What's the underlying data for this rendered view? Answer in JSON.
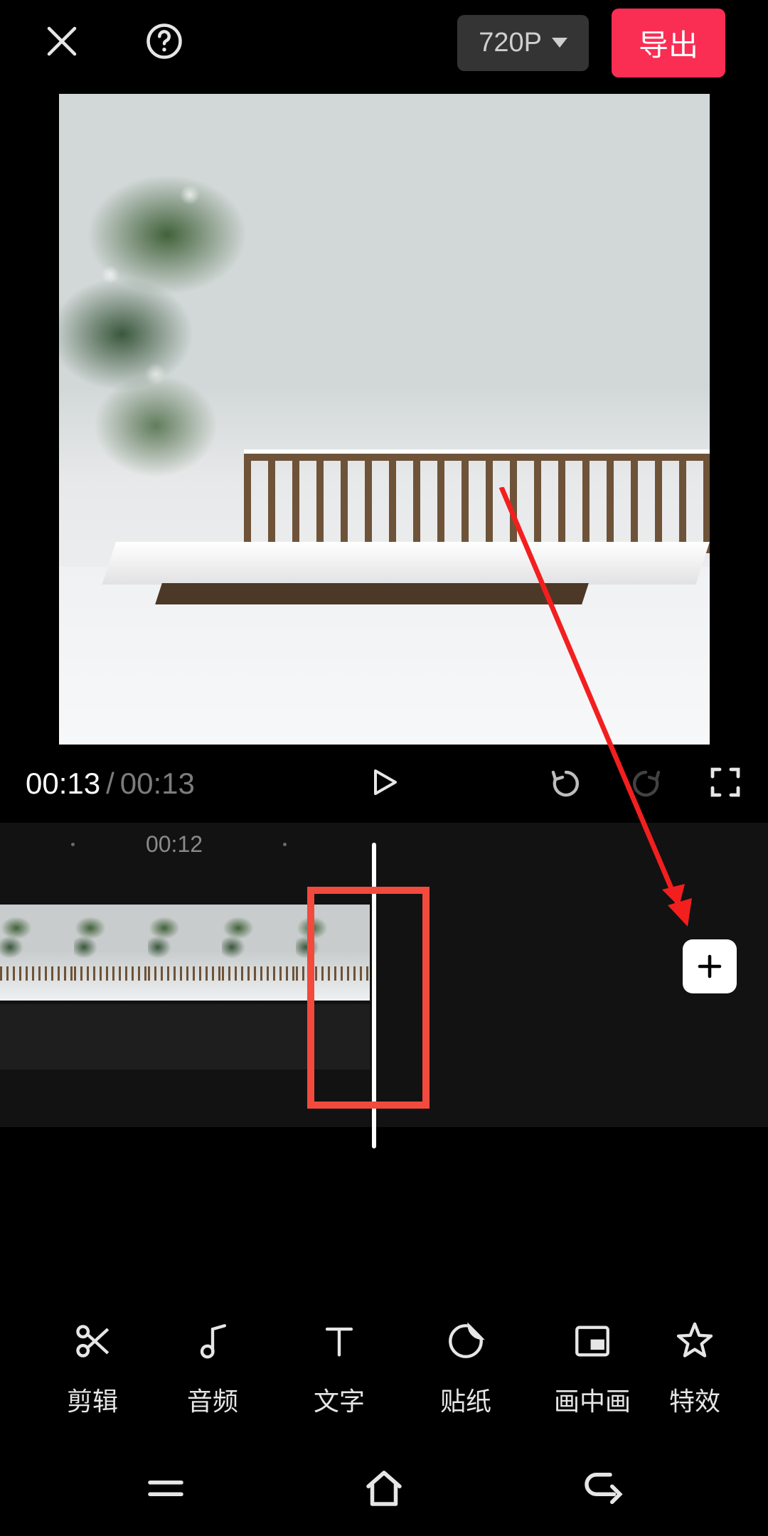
{
  "header": {
    "resolution_label": "720P",
    "export_label": "导出"
  },
  "playback": {
    "current_time": "00:13",
    "duration": "00:13",
    "separator": "/"
  },
  "timeline": {
    "ruler_label": "00:12"
  },
  "toolbar": {
    "items": [
      {
        "id": "cut",
        "label": "剪辑"
      },
      {
        "id": "audio",
        "label": "音频"
      },
      {
        "id": "text",
        "label": "文字"
      },
      {
        "id": "sticker",
        "label": "贴纸"
      },
      {
        "id": "pip",
        "label": "画中画"
      },
      {
        "id": "effects",
        "label": "特效"
      }
    ]
  },
  "annotations": {
    "highlight": "playhead-area",
    "arrow_target": "add-clip-button"
  }
}
